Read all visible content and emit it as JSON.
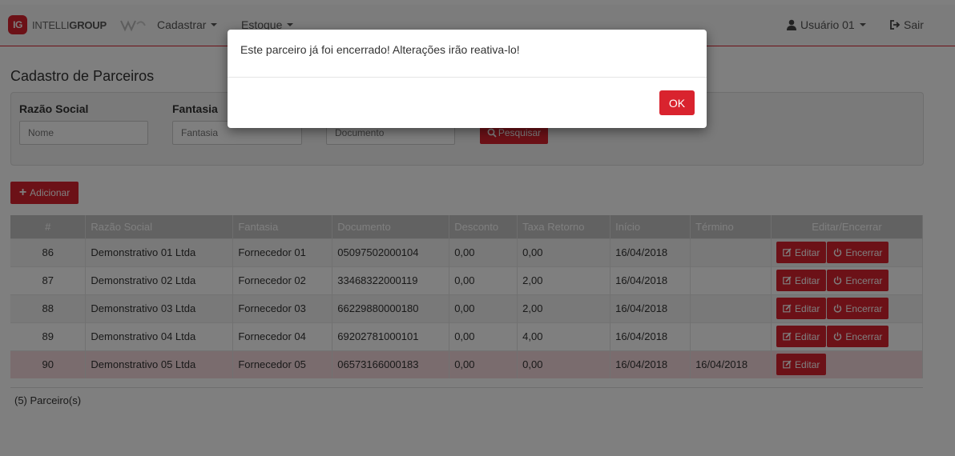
{
  "nav": {
    "brand_badge": "IG",
    "brand_name_light": "INTELLI",
    "brand_name_bold": "GROUP",
    "menu_cadastrar": "Cadastrar",
    "menu_estoque": "Estoque",
    "user_label": "Usuário 01",
    "logout_label": "Sair"
  },
  "page": {
    "title": "Cadastro de Parceiros"
  },
  "filters": {
    "razao_label": "Razão Social",
    "razao_placeholder": "Nome",
    "fantasia_label": "Fantasia",
    "fantasia_placeholder": "Fantasia",
    "documento_placeholder": "Documento",
    "search_label": "Pesquisar"
  },
  "actions": {
    "add_label": "Adicionar"
  },
  "table": {
    "headers": [
      "#",
      "Razão Social",
      "Fantasia",
      "Documento",
      "Desconto",
      "Taxa Retorno",
      "Início",
      "Término",
      "Editar/Encerrar"
    ],
    "edit_label": "Editar",
    "close_label": "Encerrar",
    "rows": [
      {
        "id": "86",
        "razao": "Demonstrativo 01 Ltda",
        "fantasia": "Fornecedor 01",
        "documento": "05097502000104",
        "desconto": "0,00",
        "taxa": "0,00",
        "inicio": "16/04/2018",
        "termino": ""
      },
      {
        "id": "87",
        "razao": "Demonstrativo 02 Ltda",
        "fantasia": "Fornecedor 02",
        "documento": "33468322000119",
        "desconto": "0,00",
        "taxa": "2,00",
        "inicio": "16/04/2018",
        "termino": ""
      },
      {
        "id": "88",
        "razao": "Demonstrativo 03 Ltda",
        "fantasia": "Fornecedor 03",
        "documento": "66229880000180",
        "desconto": "0,00",
        "taxa": "2,00",
        "inicio": "16/04/2018",
        "termino": ""
      },
      {
        "id": "89",
        "razao": "Demonstrativo 04 Ltda",
        "fantasia": "Fornecedor 04",
        "documento": "69202781000101",
        "desconto": "0,00",
        "taxa": "4,00",
        "inicio": "16/04/2018",
        "termino": ""
      },
      {
        "id": "90",
        "razao": "Demonstrativo 05 Ltda",
        "fantasia": "Fornecedor 05",
        "documento": "06573166000183",
        "desconto": "0,00",
        "taxa": "0,00",
        "inicio": "16/04/2018",
        "termino": "16/04/2018"
      }
    ],
    "footer_count": "(5) Parceiro(s)"
  },
  "modal": {
    "message": "Este parceiro já foi encerrado! Alterações irão reativa-lo!",
    "ok_label": "OK"
  },
  "colors": {
    "accent": "#d9232e",
    "closed_row": "#f5d9dc"
  }
}
